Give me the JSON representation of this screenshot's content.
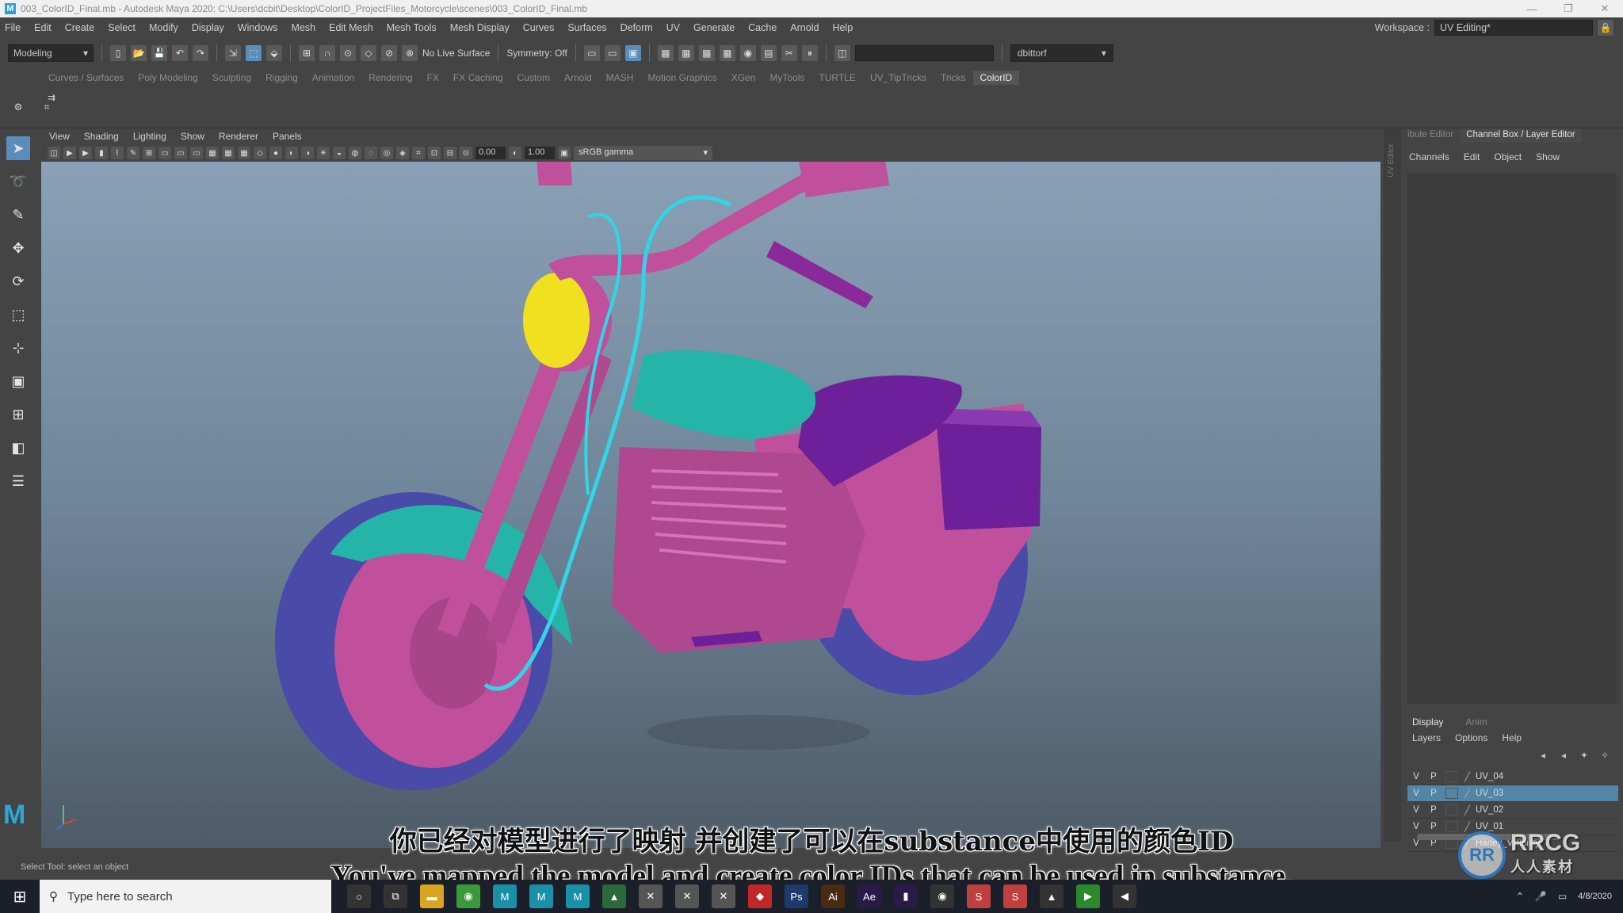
{
  "window": {
    "title": "003_ColorID_Final.mb - Autodesk Maya 2020: C:\\Users\\dcbit\\Desktop\\ColorID_ProjectFiles_Motorcycle\\scenes\\003_ColorID_Final.mb"
  },
  "menu": {
    "items": [
      "File",
      "Edit",
      "Create",
      "Select",
      "Modify",
      "Display",
      "Windows",
      "Mesh",
      "Edit Mesh",
      "Mesh Tools",
      "Mesh Display",
      "Curves",
      "Surfaces",
      "Deform",
      "UV",
      "Generate",
      "Cache",
      "Arnold",
      "Help"
    ],
    "workspace_label": "Workspace :",
    "workspace_value": "UV Editing*"
  },
  "statusline": {
    "mode": "Modeling",
    "live_surface": "No Live Surface",
    "symmetry": "Symmetry: Off",
    "user": "dbittorf"
  },
  "shelf": {
    "tabs": [
      "Curves / Surfaces",
      "Poly Modeling",
      "Sculpting",
      "Rigging",
      "Animation",
      "Rendering",
      "FX",
      "FX Caching",
      "Custom",
      "Arnold",
      "MASH",
      "Motion Graphics",
      "XGen",
      "MyTools",
      "TURTLE",
      "UV_TipTricks",
      "Tricks",
      "ColorID"
    ],
    "active_tab": "ColorID"
  },
  "viewport": {
    "menu": [
      "View",
      "Shading",
      "Lighting",
      "Show",
      "Renderer",
      "Panels"
    ],
    "exposure": "0.00",
    "gamma": "1.00",
    "color_space": "sRGB gamma"
  },
  "right_panel": {
    "uv_strip": "UV Editor",
    "tabs": [
      "ibute Editor",
      "Channel Box / Layer Editor"
    ],
    "channel_menu": [
      "Channels",
      "Edit",
      "Object",
      "Show"
    ],
    "layer_tabs": [
      "Display",
      "Anim"
    ],
    "layer_menu": [
      "Layers",
      "Options",
      "Help"
    ],
    "layers": [
      {
        "v": "V",
        "p": "P",
        "name": "UV_04",
        "selected": false
      },
      {
        "v": "V",
        "p": "P",
        "name": "UV_03",
        "selected": true
      },
      {
        "v": "V",
        "p": "P",
        "name": "UV_02",
        "selected": false
      },
      {
        "v": "V",
        "p": "P",
        "name": "UV_01",
        "selected": false
      },
      {
        "v": "V",
        "p": "P",
        "name": "Harley_Visibility",
        "selected": false
      }
    ]
  },
  "helpline": "Select Tool: select an object",
  "subtitles": {
    "cn": "你已经对模型进行了映射 并创建了可以在substance中使用的颜色ID",
    "en": "You've mapped the model and create color IDs that can be used in substance."
  },
  "taskbar": {
    "search_placeholder": "Type here to search",
    "time": "",
    "date": "4/8/2020"
  },
  "watermark": {
    "logo_text": "RRCG",
    "sub_text": "人人素材"
  },
  "colors": {
    "accent": "#5a8dbb",
    "bike_body": "#c0509c",
    "bike_tank": "#24b5a8",
    "bike_seat": "#6e1f9a",
    "bike_tire": "#4a4aa8",
    "headlight": "#f0e020",
    "cable": "#30d6e6"
  }
}
